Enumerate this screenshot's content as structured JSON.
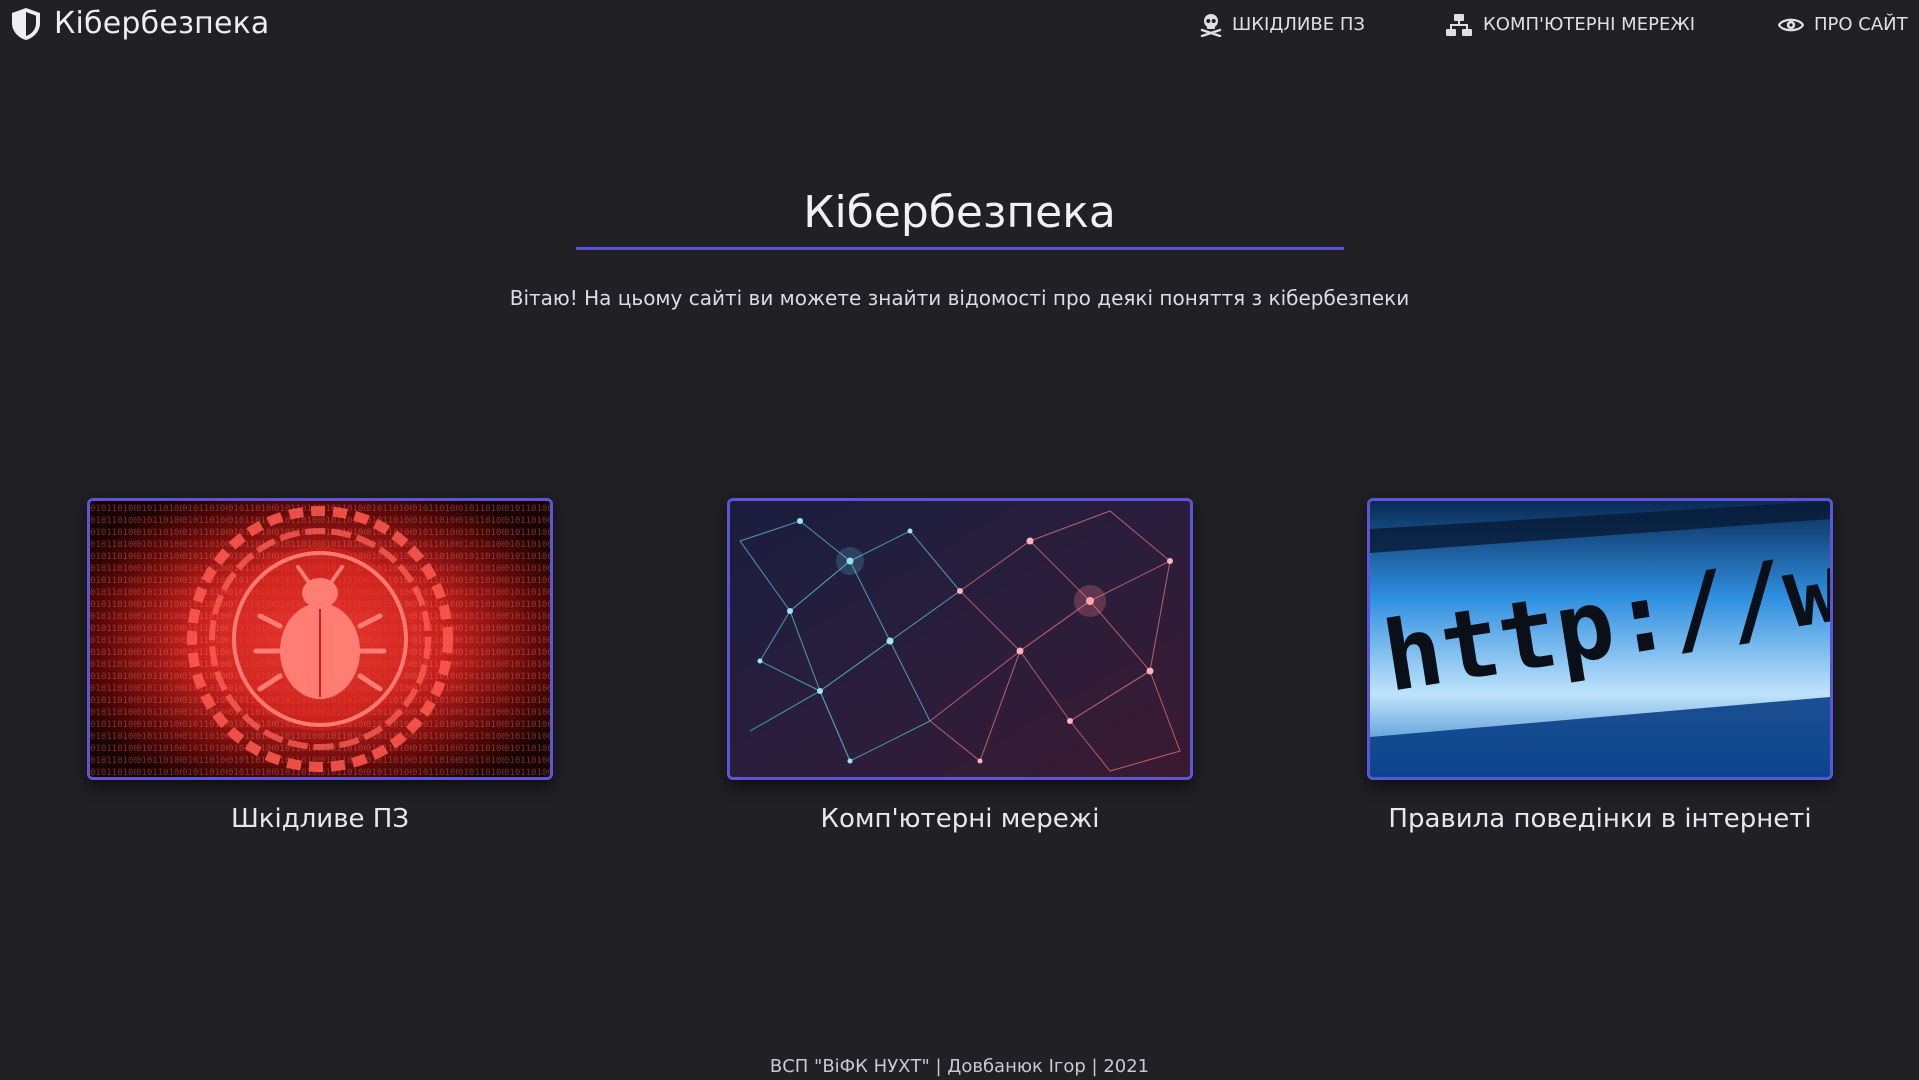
{
  "navbar": {
    "brand": {
      "icon": "shield-icon",
      "title": "Кібербезпека"
    },
    "items": [
      {
        "icon": "skull-crossbones-icon",
        "label": "ШКІДЛИВЕ ПЗ"
      },
      {
        "icon": "network-icon",
        "label": "КОМП'ЮТЕРНІ МЕРЕЖІ"
      },
      {
        "icon": "eye-icon",
        "label": "ПРО САЙТ"
      }
    ]
  },
  "hero": {
    "title": "Кібербезпека",
    "subtitle": "Вітаю! На цьому сайті ви можете знайти відомості про деякі поняття з кібербезпеки"
  },
  "cards": [
    {
      "image": "malware-bug-image",
      "caption": "Шкідливе ПЗ"
    },
    {
      "image": "network-mesh-image",
      "caption": "Комп'ютерні мережі"
    },
    {
      "image": "http-address-bar-image",
      "caption": "Правила поведінки в інтернеті",
      "image_text": "http://w"
    }
  ],
  "footer": {
    "text": "ВСП \"ВіФК НУХТ\" | Довбанюк Ігор | 2021"
  },
  "colors": {
    "background": "#202025",
    "accent": "#5b52d6",
    "text": "#e6e6ea"
  }
}
